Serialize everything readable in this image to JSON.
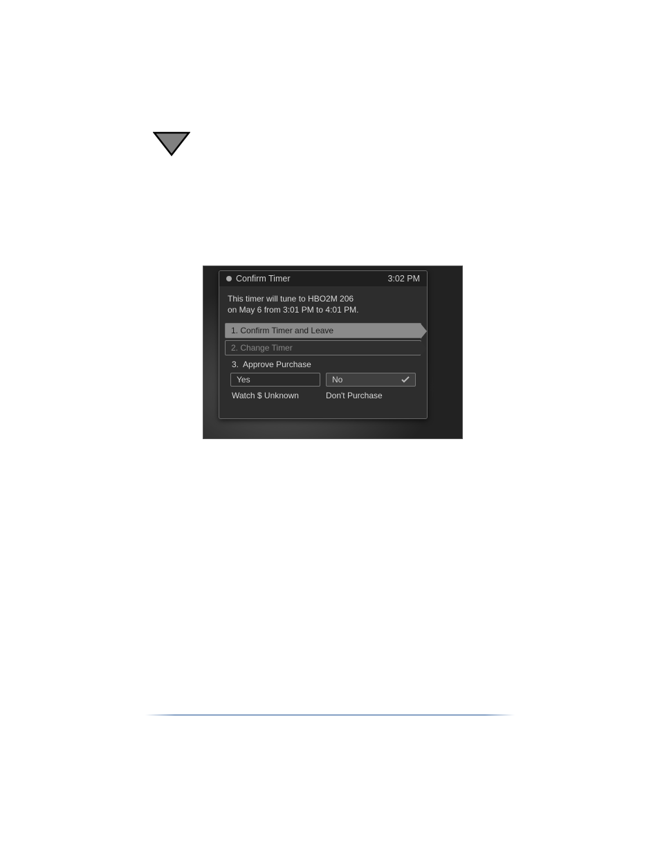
{
  "dialog": {
    "title": "Confirm Timer",
    "time": "3:02 PM",
    "message_line1": "This timer will tune to HBO2M 206",
    "message_line2": "on May 6 from 3:01 PM to 4:01 PM.",
    "options": [
      {
        "num": "1.",
        "label": "Confirm Timer and Leave"
      },
      {
        "num": "2.",
        "label": "Change Timer"
      }
    ],
    "approve_label_num": "3.",
    "approve_label_text": "Approve Purchase",
    "yes_label": "Yes",
    "no_label": "No",
    "yes_sub": "Watch $ Unknown",
    "no_sub": "Don't Purchase"
  }
}
